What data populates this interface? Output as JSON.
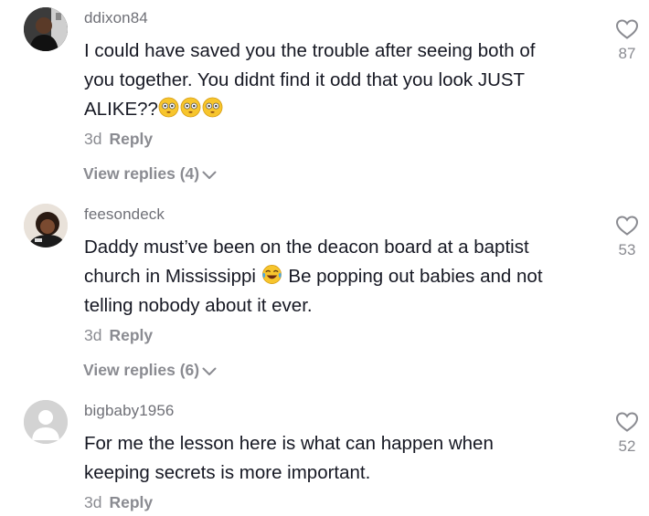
{
  "comments": [
    {
      "username": "ddixon84",
      "text": "I could have saved you the trouble after seeing both of you together. You didnt find it odd that you look JUST ALIKE??",
      "text_line1": "I could have saved you the trouble after seeing both of",
      "text_line2": "you together. You didnt find it odd that you look JUST",
      "text_line3": "ALIKE??",
      "emoji": [
        "flushed-face",
        "flushed-face",
        "flushed-face"
      ],
      "time": "3d",
      "reply_label": "Reply",
      "view_replies": "View replies (4)",
      "likes": "87"
    },
    {
      "username": "feesondeck",
      "text_line1": "Daddy must’ve been on the deacon board at a baptist",
      "text_line2a": "church in Mississippi",
      "text_line2b": "Be popping out babies and not",
      "text_line3": "telling nobody about it ever.",
      "emoji": [
        "tears-of-joy-face"
      ],
      "time": "3d",
      "reply_label": "Reply",
      "view_replies": "View replies (6)",
      "likes": "53"
    },
    {
      "username": "bigbaby1956",
      "text_line1": "For me the lesson here is what can happen when",
      "text_line2": "keeping secrets is more important.",
      "time": "3d",
      "reply_label": "Reply",
      "likes": "52"
    }
  ],
  "icons": {
    "like": "heart-outline-icon",
    "expand": "chevron-down-icon",
    "default_avatar": "default-avatar-icon"
  },
  "colors": {
    "text": "#161823",
    "secondary": "#8a8b91",
    "username": "#6f7077"
  }
}
